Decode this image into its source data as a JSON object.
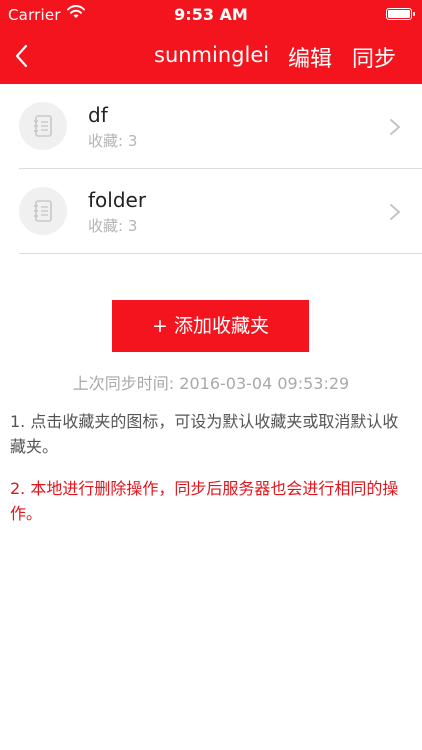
{
  "status": {
    "carrier": "Carrier",
    "time": "9:53 AM"
  },
  "nav": {
    "username": "sunminglei",
    "edit_label": "编辑",
    "sync_label": "同步"
  },
  "folders": [
    {
      "name": "df",
      "count": "收藏: 3"
    },
    {
      "name": "folder",
      "count": "收藏: 3"
    }
  ],
  "add_button_label": "+ 添加收藏夹",
  "last_sync": {
    "label": "上次同步时间:",
    "value": "2016-03-04 09:53:29"
  },
  "notes": {
    "note1": "1. 点击收藏夹的图标，可设为默认收藏夹或取消默认收藏夹。",
    "note2": "2. 本地进行删除操作，同步后服务器也会进行相同的操作。"
  },
  "colors": {
    "brand_red": "#f4141e",
    "note_red": "#e2141c",
    "muted_text": "#a9a9a9"
  },
  "icons": {
    "wifi": "wifi-icon",
    "battery": "battery-icon",
    "back": "chevron-left-icon",
    "folder_avatar": "notebook-icon",
    "row_chevron": "chevron-right-icon"
  }
}
